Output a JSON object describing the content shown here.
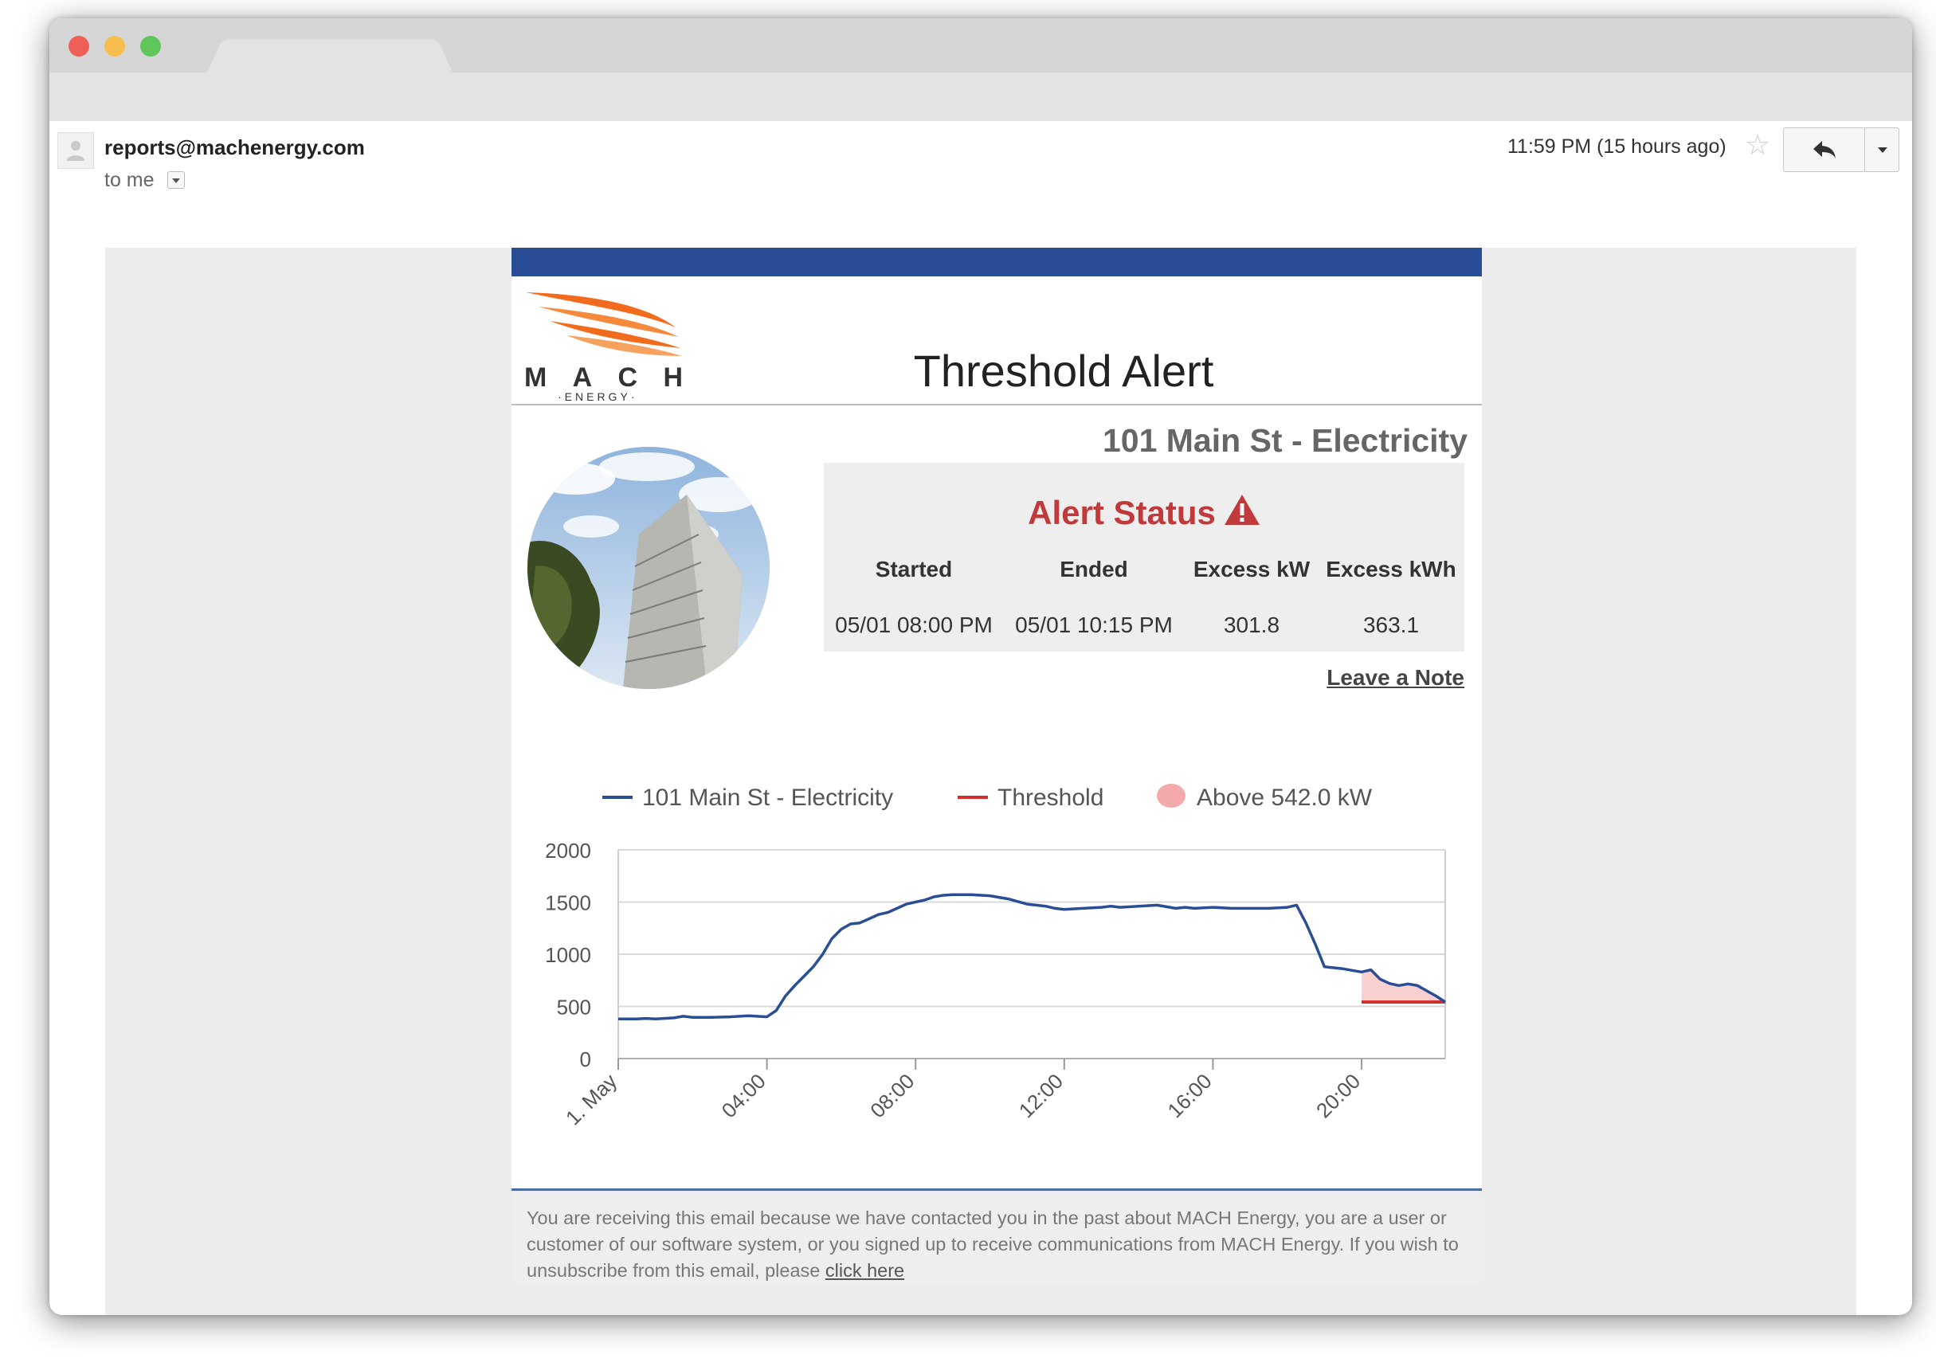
{
  "email": {
    "sender": "reports@machenergy.com",
    "recipient": "to me",
    "timestamp": "11:59 PM (15 hours ago)"
  },
  "brand": {
    "logo_word": "MACH",
    "logo_sub": "·ENERGY·",
    "bar_color": "#2a4e96",
    "accent_orange": "#f26b1d"
  },
  "alert": {
    "title": "Threshold Alert",
    "site": "101 Main St - Electricity",
    "status_title": "Alert Status",
    "status_color": "#c0393b",
    "columns": [
      "Started",
      "Ended",
      "Excess kW",
      "Excess kWh"
    ],
    "values": [
      "05/01 08:00 PM",
      "05/01 10:15 PM",
      "301.8",
      "363.1"
    ],
    "leave_note": "Leave a Note"
  },
  "chart_data": {
    "type": "line",
    "legend": [
      {
        "label": "101 Main St - Electricity",
        "color": "#2a4e96",
        "kind": "line"
      },
      {
        "label": "Threshold",
        "color": "#d32f2f",
        "kind": "line"
      },
      {
        "label": "Above 542.0 kW",
        "color": "#f2aaaa",
        "kind": "area"
      }
    ],
    "legend_position": "top",
    "ylim": [
      0,
      2000
    ],
    "yticks": [
      0,
      500,
      1000,
      1500,
      2000
    ],
    "xlim": [
      0,
      22.25
    ],
    "xticks": [
      0,
      4,
      8,
      12,
      16,
      20
    ],
    "xtick_labels": [
      "1. May",
      "04:00",
      "08:00",
      "12:00",
      "16:00",
      "20:00"
    ],
    "grid": "horizontal",
    "threshold": {
      "value": 542,
      "x": [
        20,
        22.25
      ]
    },
    "series": [
      {
        "name": "101 Main St - Electricity",
        "color": "#2a4e96",
        "x": [
          0,
          0.5,
          0.75,
          1,
          1.5,
          1.75,
          2,
          2.5,
          3,
          3.5,
          4,
          4.25,
          4.5,
          4.75,
          5,
          5.25,
          5.5,
          5.75,
          6,
          6.25,
          6.5,
          6.75,
          7,
          7.25,
          7.5,
          7.75,
          8,
          8.25,
          8.5,
          8.75,
          9,
          9.5,
          10,
          10.5,
          11,
          11.25,
          11.5,
          11.75,
          12,
          12.5,
          13,
          13.25,
          13.5,
          14,
          14.5,
          15,
          15.25,
          15.5,
          16,
          16.5,
          17,
          17.5,
          18,
          18.25,
          18.5,
          18.75,
          19,
          19.5,
          20,
          20.25,
          20.5,
          20.75,
          21,
          21.25,
          21.5,
          21.75,
          22,
          22.25
        ],
        "y": [
          380,
          380,
          385,
          380,
          390,
          405,
          395,
          395,
          400,
          410,
          400,
          460,
          600,
          700,
          790,
          880,
          1000,
          1150,
          1240,
          1290,
          1300,
          1340,
          1380,
          1400,
          1440,
          1480,
          1500,
          1520,
          1550,
          1565,
          1570,
          1570,
          1560,
          1530,
          1480,
          1470,
          1460,
          1440,
          1430,
          1440,
          1450,
          1460,
          1450,
          1460,
          1470,
          1440,
          1450,
          1440,
          1450,
          1440,
          1440,
          1440,
          1450,
          1470,
          1300,
          1100,
          880,
          860,
          830,
          850,
          760,
          720,
          700,
          715,
          700,
          650,
          600,
          542
        ]
      }
    ]
  },
  "footer": {
    "text": "You are receiving this email because we have contacted you in the past about MACH Energy, you are a user or customer of our software system, or you signed up to receive communications from MACH Energy. If you wish to unsubscribe from this email, please",
    "link": "click here"
  }
}
